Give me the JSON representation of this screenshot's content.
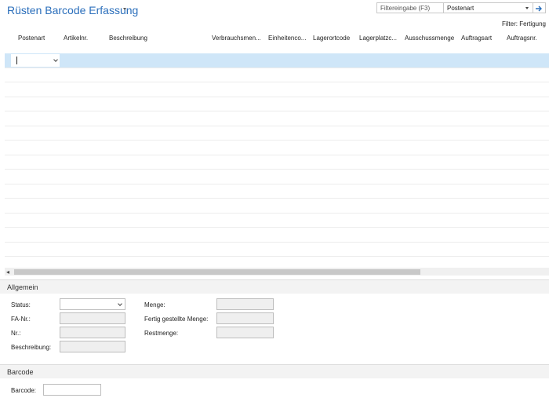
{
  "page": {
    "title": "Rüsten Barcode Erfassung"
  },
  "filter": {
    "input_placeholder": "Filtereingabe (F3)",
    "field_selected": "Postenart",
    "note": "Filter: Fertigung"
  },
  "grid": {
    "columns": [
      "Postenart",
      "Artikelnr.",
      "Beschreibung",
      "Verbrauchsmen...",
      "Einheitenco...",
      "Lagerortcode",
      "Lagerplatzc...",
      "Ausschussmenge",
      "Auftragsart",
      "Auftragsnr."
    ]
  },
  "allgemein": {
    "heading": "Allgemein",
    "status_label": "Status:",
    "fa_nr_label": "FA-Nr.:",
    "nr_label": "Nr.:",
    "beschreibung_label": "Beschreibung:",
    "menge_label": "Menge:",
    "fertig_label": "Fertig gestellte Menge:",
    "restmenge_label": "Restmenge:"
  },
  "barcode": {
    "heading": "Barcode",
    "barcode_label": "Barcode:"
  }
}
